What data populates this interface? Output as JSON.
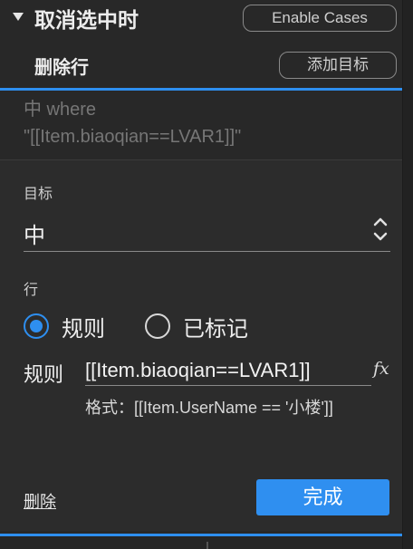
{
  "interaction": {
    "title": "取消选中时",
    "enable_cases_label": "Enable Cases"
  },
  "case": {
    "label": "删除行",
    "add_target_label": "添加目标"
  },
  "condition": {
    "line1": "中 where",
    "line2": "\"[[Item.biaoqian==LVAR1]]\""
  },
  "editor": {
    "target_label": "目标",
    "target_value": "中",
    "row_label": "行",
    "radio_options": [
      {
        "label": "规则",
        "checked": true
      },
      {
        "label": "已标记",
        "checked": false
      }
    ],
    "rule_label": "规则",
    "rule_value": "[[Item.biaoqian==LVAR1]]",
    "fx_symbol": "fx",
    "format_hint": "格式：[[Item.UserName == '小楼']]",
    "delete_label": "删除",
    "done_label": "完成"
  },
  "icons": {
    "collapse": "caret-down-icon",
    "select": "chevron-updown-icon",
    "function": "fx-icon"
  },
  "colors": {
    "accent": "#2e8ff0",
    "background": "#282828",
    "muted_text": "#767676"
  }
}
